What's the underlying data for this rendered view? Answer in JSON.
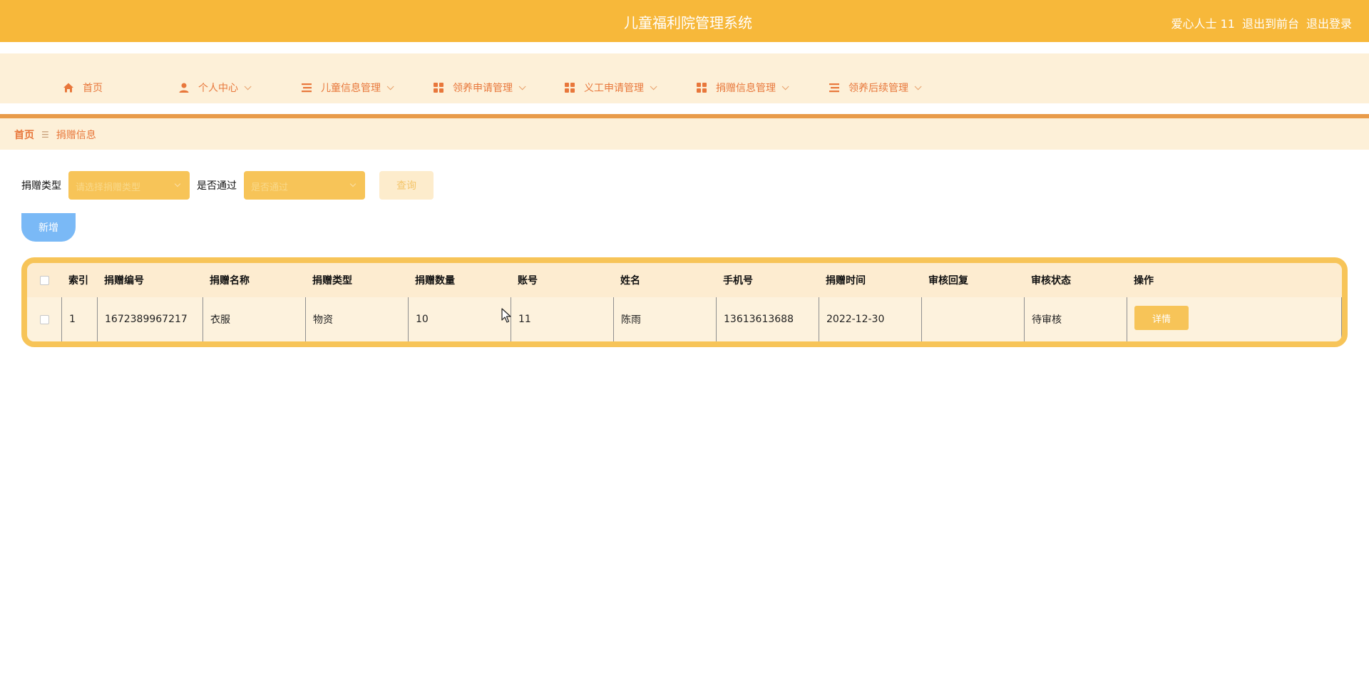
{
  "header": {
    "title": "儿童福利院管理系统",
    "user_label": "爱心人士 11",
    "back_front_label": "退出到前台",
    "logout_label": "退出登录"
  },
  "nav": {
    "items": [
      {
        "label": "首页",
        "icon": "home-icon",
        "has_dropdown": false
      },
      {
        "label": "个人中心",
        "icon": "user-icon",
        "has_dropdown": true
      },
      {
        "label": "儿童信息管理",
        "icon": "list-icon",
        "has_dropdown": true
      },
      {
        "label": "领养申请管理",
        "icon": "grid-icon",
        "has_dropdown": true
      },
      {
        "label": "义工申请管理",
        "icon": "grid-icon",
        "has_dropdown": true
      },
      {
        "label": "捐赠信息管理",
        "icon": "grid-icon",
        "has_dropdown": true
      },
      {
        "label": "领养后续管理",
        "icon": "list-icon",
        "has_dropdown": true
      }
    ]
  },
  "breadcrumb": {
    "home": "首页",
    "separator": "☰",
    "current": "捐赠信息"
  },
  "search": {
    "type_label": "捐赠类型",
    "type_placeholder": "请选择捐赠类型",
    "pass_label": "是否通过",
    "pass_placeholder": "是否通过",
    "query_label": "查询"
  },
  "actions": {
    "add_label": "新增"
  },
  "table": {
    "columns": [
      "索引",
      "捐赠编号",
      "捐赠名称",
      "捐赠类型",
      "捐赠数量",
      "账号",
      "姓名",
      "手机号",
      "捐赠时间",
      "审核回复",
      "审核状态",
      "操作"
    ],
    "rows": [
      {
        "index": "1",
        "code": "1672389967217",
        "name": "衣服",
        "type": "物资",
        "quantity": "10",
        "account": "11",
        "person": "陈雨",
        "phone": "13613613688",
        "time": "2022-12-30",
        "reply": "",
        "status": "待审核",
        "detail_label": "详情"
      }
    ]
  },
  "colors": {
    "header_bg": "#f7b83a",
    "nav_bg": "#fdf0d8",
    "accent": "#e8773b",
    "select_bg": "#f7c458",
    "add_button": "#7ab9f6"
  }
}
